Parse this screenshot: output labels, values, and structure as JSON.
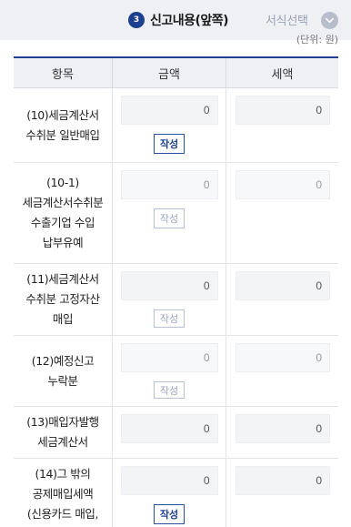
{
  "header": {
    "step_number": "3",
    "step_title": "신고내용(앞쪽)",
    "form_select_label": "서식선택",
    "chevron_icon": "chevron-down-icon",
    "unit_note": "(단위: 원)"
  },
  "table": {
    "columns": [
      "항목",
      "금액",
      "세액"
    ],
    "rows": [
      {
        "label": "(10)세금계산서 수취분 일반매입",
        "amount": "0",
        "tax": "0",
        "button": "작성",
        "button_enabled": true
      },
      {
        "label": "(10-1)세금계산서수취분 수출기업 수입 납부유예",
        "amount": "0",
        "tax": "0",
        "button": "작성",
        "button_enabled": false
      },
      {
        "label": "(11)세금계산서 수취분 고정자산 매입",
        "amount": "0",
        "tax": "0",
        "button": "작성",
        "button_enabled": false
      },
      {
        "label": "(12)예정신고 누락분",
        "amount": "0",
        "tax": "0",
        "button": "작성",
        "button_enabled": false
      },
      {
        "label": "(13)매입자발행 세금계산서",
        "amount": "0",
        "tax": "0"
      },
      {
        "label": "(14)그 밖의 공제매입세액 (신용카드 매입,",
        "amount": "0",
        "tax": "0",
        "button": "작성",
        "button_enabled": true
      }
    ]
  },
  "colors": {
    "accent": "#1d3f8f",
    "header_bg": "#eef0f4",
    "input_bg": "#f3f4f6"
  }
}
